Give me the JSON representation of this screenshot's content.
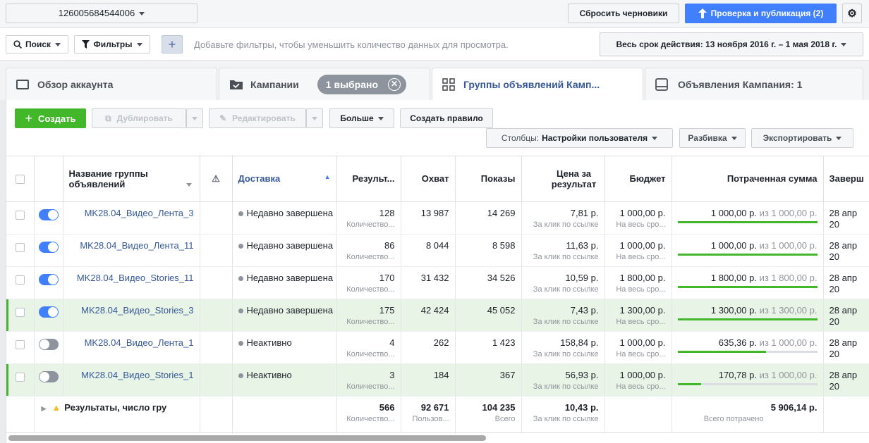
{
  "top": {
    "account_id": "126005684544006",
    "discard_label": "Сбросить черновики",
    "publish_label": "Проверка и публикация (2)"
  },
  "filters": {
    "search_label": "Поиск",
    "filters_label": "Фильтры",
    "add_label": "+",
    "hint": "Добавьте фильтры, чтобы уменьшить количество данных для просмотра.",
    "date_range": "Весь срок действия: 13 ноября 2016 г. – 1 мая 2018 г."
  },
  "tabs": {
    "overview": "Обзор аккаунта",
    "campaigns": "Кампании",
    "selected_pill": "1 выбрано",
    "adsets": "Группы объявлений Камп...",
    "ads": "Объявления Кампания: 1"
  },
  "toolbar": {
    "create": "Создать",
    "duplicate": "Дублировать",
    "edit": "Редактировать",
    "more": "Больше",
    "create_rule": "Создать правило",
    "columns_prefix": "Столбцы:",
    "columns_value": "Настройки пользователя",
    "breakdown": "Разбивка",
    "export": "Экспортировать"
  },
  "columns": {
    "name": "Название группы объявлений",
    "delivery": "Доставка",
    "results": "Результ...",
    "reach": "Охват",
    "impressions": "Показы",
    "cost": "Цена за результат",
    "budget": "Бюджет",
    "spent": "Потраченная сумма",
    "ends": "Заверш"
  },
  "rows": [
    {
      "on": true,
      "selected": false,
      "name": "MK28.04_Видео_Лента_3",
      "delivery": "Недавно завершена",
      "results": "128",
      "results_sub": "Количество...",
      "reach": "13 987",
      "impressions": "14 269",
      "cost": "7,81 р.",
      "cost_sub": "За клик по ссылке",
      "budget": "1 000,00 р.",
      "budget_sub": "На весь сро...",
      "spent": "1 000,00 р.",
      "spent_of": "из 1 000,00 р.",
      "spent_pct": 1.0,
      "end": "28 апр",
      "end2": "20"
    },
    {
      "on": true,
      "selected": false,
      "name": "MK28.04_Видео_Лента_11",
      "delivery": "Недавно завершена",
      "results": "86",
      "results_sub": "Количество...",
      "reach": "8 044",
      "impressions": "8 598",
      "cost": "11,63 р.",
      "cost_sub": "За клик по ссылке",
      "budget": "1 000,00 р.",
      "budget_sub": "На весь сро...",
      "spent": "1 000,00 р.",
      "spent_of": "из 1 000,00 р.",
      "spent_pct": 1.0,
      "end": "28 апр",
      "end2": "20"
    },
    {
      "on": true,
      "selected": false,
      "name": "MK28.04_Видео_Stories_11",
      "delivery": "Недавно завершена",
      "results": "170",
      "results_sub": "Количество...",
      "reach": "31 432",
      "impressions": "34 526",
      "cost": "10,59 р.",
      "cost_sub": "За клик по ссылке",
      "budget": "1 800,00 р.",
      "budget_sub": "На весь сро...",
      "spent": "1 800,00 р.",
      "spent_of": "из 1 800,00 р.",
      "spent_pct": 1.0,
      "end": "28 апр",
      "end2": "20"
    },
    {
      "on": true,
      "selected": true,
      "name": "MK28.04_Видео_Stories_3",
      "delivery": "Недавно завершена",
      "results": "175",
      "results_sub": "Количество...",
      "reach": "42 424",
      "impressions": "45 052",
      "cost": "7,43 р.",
      "cost_sub": "За клик по ссылке",
      "budget": "1 300,00 р.",
      "budget_sub": "На весь сро...",
      "spent": "1 300,00 р.",
      "spent_of": "из 1 300,00 р.",
      "spent_pct": 1.0,
      "end": "28 апр",
      "end2": "20"
    },
    {
      "on": false,
      "selected": false,
      "name": "MK28.04_Видео_Лента_1",
      "delivery": "Неактивно",
      "results": "4",
      "results_sub": "Количество...",
      "reach": "262",
      "impressions": "1 423",
      "cost": "158,84 р.",
      "cost_sub": "За клик по ссылке",
      "budget": "1 000,00 р.",
      "budget_sub": "На весь сро...",
      "spent": "635,36 р.",
      "spent_of": "из 1 000,00 р.",
      "spent_pct": 0.635,
      "end": "28 апр",
      "end2": "20"
    },
    {
      "on": false,
      "selected": true,
      "name": "MK28.04_Видео_Stories_1",
      "delivery": "Неактивно",
      "results": "3",
      "results_sub": "Количество...",
      "reach": "184",
      "impressions": "367",
      "cost": "56,93 р.",
      "cost_sub": "За клик по ссылке",
      "budget": "1 000,00 р.",
      "budget_sub": "На весь сро...",
      "spent": "170,78 р.",
      "spent_of": "из 1 000,00 р.",
      "spent_pct": 0.171,
      "end": "28 апр",
      "end2": "20"
    }
  ],
  "totals": {
    "label": "Результаты, число гру",
    "results": "566",
    "results_sub": "Количество...",
    "reach": "92 671",
    "reach_sub": "Пользов...",
    "impressions": "104 235",
    "impressions_sub": "Всего",
    "cost": "10,43 р.",
    "cost_sub": "За клик по ссылке",
    "spent": "5 906,14 р.",
    "spent_sub": "Всего потрачено"
  },
  "colors": {
    "accent": "#4080ff",
    "green": "#42b72a",
    "link": "#365899"
  }
}
